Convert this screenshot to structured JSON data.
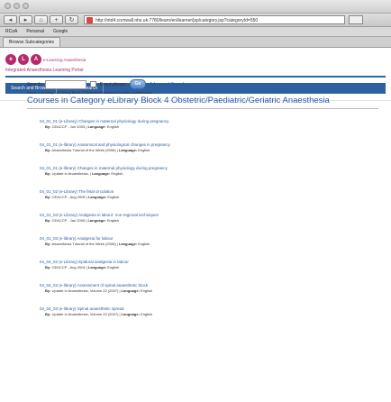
{
  "browser": {
    "address": "http://ntd4.cornwall.nhs.uk:7780/learn/en/learner/jsp/category.jsp?categoryId=550",
    "bookmarks": [
      "RCoA",
      "Personal",
      "Google"
    ],
    "tab": "Browse Subcategories",
    "buttons": {
      "back": "◂",
      "forward": "▸",
      "home": "⌂",
      "add": "+",
      "reload": "↻"
    }
  },
  "header": {
    "logo_letters": [
      "e",
      "L",
      "A"
    ],
    "logo_text": "e-Learning Anaesthesia",
    "portal_title": "Integrated Anaesthesia Learning Portal",
    "nav": [
      "Search and Browse",
      "Advanced Search"
    ]
  },
  "search": {
    "label": "Search",
    "exact_phrase": "Exact phrase",
    "go": "Go",
    "advanced": "Advanced Search..."
  },
  "breadcrumb": "Home > eLibrary > eLibrary Block 4 Obstetric/Paediatric/Geriatric Anaesthesia",
  "page_title": "Courses in Category eLibrary Block 4 Obstetric/Paediatric/Geriatric Anaesthesia",
  "items": [
    {
      "title": "04_01_01 (e-Library) Changes in maternal physiology during pregnancy",
      "by": "By:",
      "meta": "CEACCP - Jun 2003",
      "lang_label": "Language:",
      "lang": "English"
    },
    {
      "title": "04_01_01 (e-library) Anatomical and physiological changes in pregnancy",
      "by": "By:",
      "meta": "Anaesthesia Tutorial of the Week (2008)",
      "lang_label": "Language:",
      "lang": "English"
    },
    {
      "title": "04_01_01 (e-library) Changes in maternal physiology during pregnancy",
      "by": "By:",
      "meta": "Update in Anaesthesia,",
      "lang_label": "Language:",
      "lang": "English"
    },
    {
      "title": "04_01_02 (e-Library) The fetal circulation",
      "by": "By:",
      "meta": "CEACCP - Aug 2005",
      "lang_label": "Language:",
      "lang": "English"
    },
    {
      "title": "04_01_03 (e-Library) Analgesia in labour: non-regional techniques",
      "by": "By:",
      "meta": "CEACCP - Jan 2005",
      "lang_label": "Language:",
      "lang": "English"
    },
    {
      "title": "04_01_03 (e-library) Analgesia for labour",
      "by": "By:",
      "meta": "Anaesthesia Tutorial of the Week (2008)",
      "lang_label": "Language:",
      "lang": "English"
    },
    {
      "title": "04_04_02 (e-Library) Epidural analgesia in labour",
      "by": "By:",
      "meta": "CEACCP - Aug 2004",
      "lang_label": "Language:",
      "lang": "English"
    },
    {
      "title": "04_04_03 (e-library) Assessment of spinal anaesthetic block",
      "by": "By:",
      "meta": "Update in Anaesthesia, Volume 22 (2007)",
      "lang_label": "Language:",
      "lang": "English"
    },
    {
      "title": "04_04_03 (e-library) Spinal anaesthetic spread",
      "by": "By:",
      "meta": "Update in Anaesthesia, Volume 23 (2007)",
      "lang_label": "Language:",
      "lang": "English"
    }
  ],
  "colors": {
    "brand": "#b62a6b",
    "nav": "#2e5f9e",
    "link": "#2a5aa6"
  }
}
